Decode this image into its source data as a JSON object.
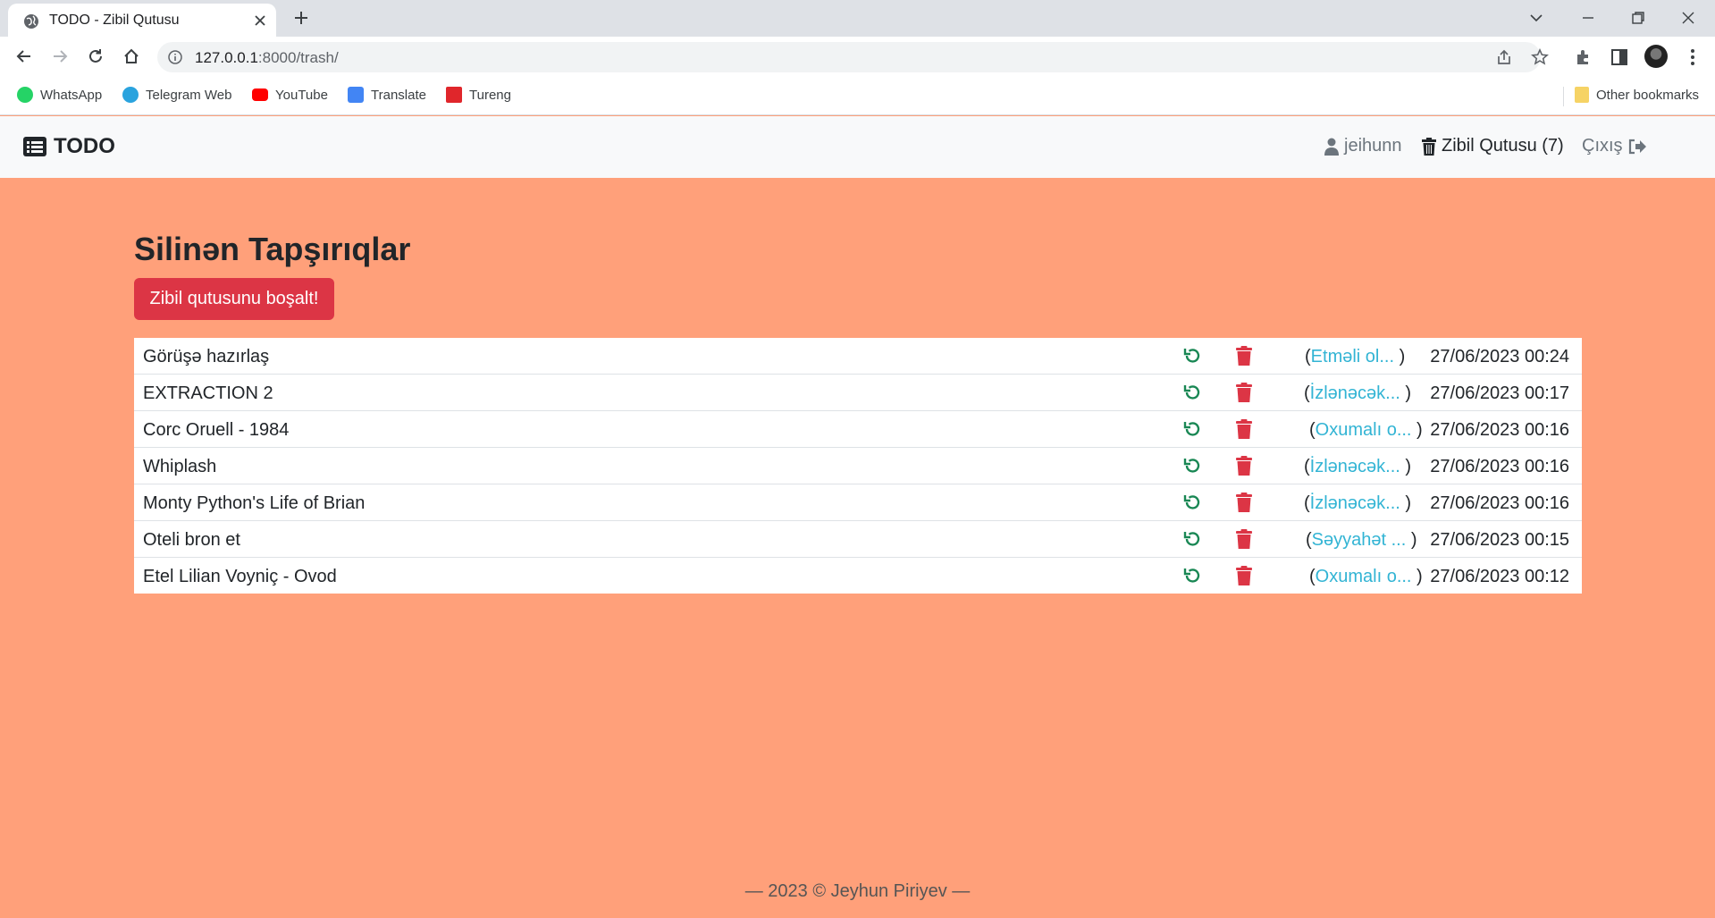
{
  "browser": {
    "tab_title": "TODO - Zibil Qutusu",
    "url_host": "127.0.0.1",
    "url_rest": ":8000/trash/",
    "bookmarks": [
      {
        "label": "WhatsApp",
        "icon": "whatsapp-icon",
        "color": "#25d366"
      },
      {
        "label": "Telegram Web",
        "icon": "telegram-icon",
        "color": "#2aa3de"
      },
      {
        "label": "YouTube",
        "icon": "youtube-icon",
        "color": "#ff0000"
      },
      {
        "label": "Translate",
        "icon": "translate-icon",
        "color": "#4285f4"
      },
      {
        "label": "Tureng",
        "icon": "tureng-icon",
        "color": "#e0262b"
      }
    ],
    "other_bookmarks": "Other bookmarks"
  },
  "navbar": {
    "brand": "TODO",
    "user": "jeihunn",
    "trash": "Zibil Qutusu (7)",
    "logout": "Çıxış"
  },
  "main": {
    "title": "Silinən Tapşırıqlar",
    "empty_button": "Zibil qutusunu boşalt!",
    "tasks": [
      {
        "title": "Görüşə hazırlaş",
        "category": "Etməli ol...",
        "date": "27/06/2023 00:24"
      },
      {
        "title": "EXTRACTION 2",
        "category": "İzlənəcək...",
        "date": "27/06/2023 00:17"
      },
      {
        "title": "Corc Oruell - 1984",
        "category": "Oxumalı o...",
        "date": "27/06/2023 00:16"
      },
      {
        "title": "Whiplash",
        "category": "İzlənəcək...",
        "date": "27/06/2023 00:16"
      },
      {
        "title": "Monty Python's Life of Brian",
        "category": "İzlənəcək...",
        "date": "27/06/2023 00:16"
      },
      {
        "title": "Oteli bron et",
        "category": "Səyyahət ...",
        "date": "27/06/2023 00:15"
      },
      {
        "title": "Etel Lilian Voyniç - Ovod",
        "category": "Oxumalı o...",
        "date": "27/06/2023 00:12"
      }
    ]
  },
  "footer": {
    "text": "— 2023 © Jeyhun Piriyev —"
  },
  "colors": {
    "page_bg": "#ffa07a",
    "danger": "#dc3545",
    "restore": "#198754",
    "link": "#32b4d4"
  }
}
